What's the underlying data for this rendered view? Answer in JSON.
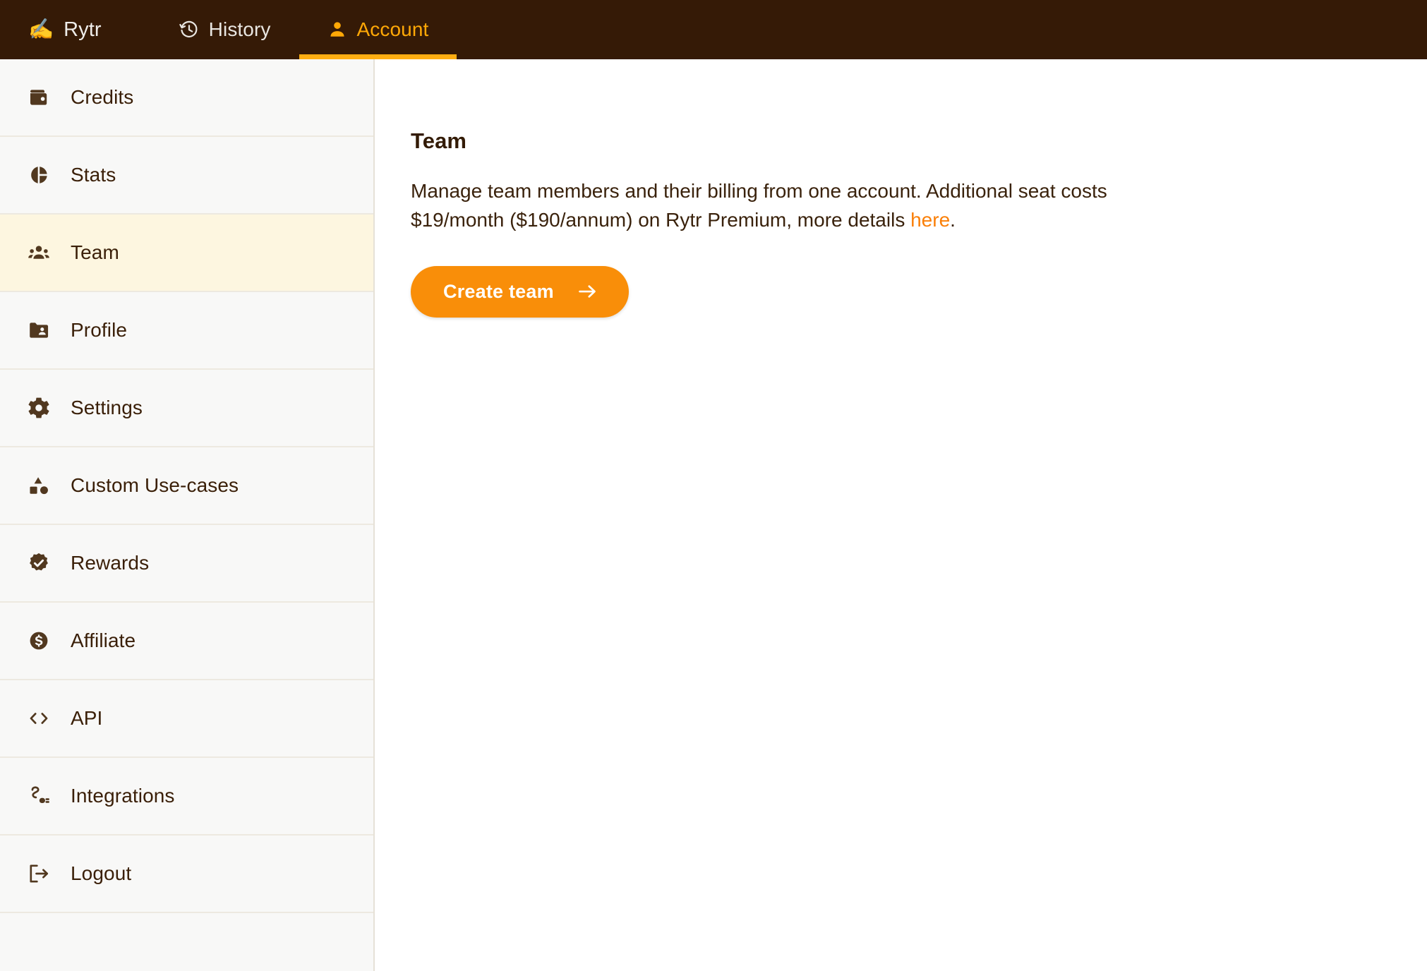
{
  "topbar": {
    "brand": {
      "label": "Rytr",
      "icon": "writing-hand-emoji",
      "emoji": "✍️"
    },
    "items": [
      {
        "label": "History",
        "icon": "history-clock-icon",
        "active": false
      },
      {
        "label": "Account",
        "icon": "person-icon",
        "active": true
      }
    ],
    "background": "#351A06",
    "active_color": "#FFA806",
    "underline_color": "#FFAE12"
  },
  "sidebar": {
    "background": "#F8F8F7",
    "active_background": "#FDF6E0",
    "items": [
      {
        "label": "Credits",
        "icon": "wallet-icon",
        "active": false
      },
      {
        "label": "Stats",
        "icon": "pie-chart-icon",
        "active": false
      },
      {
        "label": "Team",
        "icon": "people-group-icon",
        "active": true
      },
      {
        "label": "Profile",
        "icon": "folder-user-icon",
        "active": false
      },
      {
        "label": "Settings",
        "icon": "gear-icon",
        "active": false
      },
      {
        "label": "Custom Use-cases",
        "icon": "shapes-icon",
        "active": false
      },
      {
        "label": "Rewards",
        "icon": "verified-badge-icon",
        "active": false
      },
      {
        "label": "Affiliate",
        "icon": "dollar-coin-icon",
        "active": false
      },
      {
        "label": "API",
        "icon": "code-brackets-icon",
        "active": false
      },
      {
        "label": "Integrations",
        "icon": "plug-cable-icon",
        "active": false
      },
      {
        "label": "Logout",
        "icon": "sign-out-icon",
        "active": false
      }
    ]
  },
  "main": {
    "title": "Team",
    "description_part1": "Manage team members and their billing from one account. Additional seat costs $19/month ($190/annum) on Rytr Premium, more details ",
    "description_link": "here",
    "description_part2": ".",
    "create_team_button": "Create team",
    "create_team_icon": "arrow-right-icon",
    "accent_color": "#F98E09",
    "link_color": "#FA7F08"
  }
}
